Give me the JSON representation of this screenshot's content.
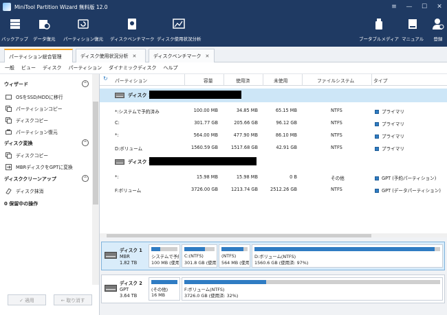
{
  "window": {
    "title": "MiniTool Partition Wizard 無料版 12.0"
  },
  "toolbar": {
    "items": [
      {
        "label": "バックアップ",
        "icon": "backup-icon"
      },
      {
        "label": "データ復元",
        "icon": "data-recovery-icon"
      },
      {
        "label": "パーティション復元",
        "icon": "partition-recovery-icon"
      },
      {
        "label": "ディスクベンチマーク",
        "icon": "disk-benchmark-icon"
      },
      {
        "label": "ディスク使用状況分析",
        "icon": "space-analyzer-icon"
      },
      {
        "label": "ブータブルメディア",
        "icon": "bootable-media-icon"
      },
      {
        "label": "マニュアル",
        "icon": "manual-icon"
      },
      {
        "label": "登録",
        "icon": "register-icon"
      }
    ]
  },
  "tabs": [
    {
      "label": "パーティション総合管理"
    },
    {
      "label": "ディスク使用状況分析"
    },
    {
      "label": "ディスクベンチマーク"
    }
  ],
  "menu": [
    "一般",
    "ビュー",
    "ディスク",
    "パーティション",
    "ダイナミックディスク",
    "ヘルプ"
  ],
  "sidebar": {
    "wizard": {
      "title": "ウィザード",
      "items": [
        "OSをSSD/HDDに移行",
        "パーティションコピー",
        "ディスクコピー",
        "パーティション復元"
      ]
    },
    "convert": {
      "title": "ディスク変換",
      "items": [
        "ディスクコピー",
        "MBRディスクをGPTに変換"
      ]
    },
    "cleanup": {
      "title": "ディスククリーンアップ",
      "items": [
        "ディスク抹消"
      ]
    },
    "pending": "0 保留中の操作",
    "apply": "✓ 適用",
    "undo": "← 取り消す"
  },
  "table": {
    "headers": [
      "パーティション",
      "容量",
      "使用済",
      "未使用",
      "ファイルシステム",
      "タイプ"
    ],
    "disk1": {
      "name": "ディスク 1"
    },
    "disk1_rows": [
      [
        "*:システムで予約済み",
        "100.00 MB",
        "34.85 MB",
        "65.15 MB",
        "NTFS",
        "プライマリ"
      ],
      [
        "C:",
        "301.77 GB",
        "205.66 GB",
        "96.12 GB",
        "NTFS",
        "プライマリ"
      ],
      [
        "*:",
        "564.00 MB",
        "477.90 MB",
        "86.10 MB",
        "NTFS",
        "プライマリ"
      ],
      [
        "D:ボリューム",
        "1560.59 GB",
        "1517.68 GB",
        "42.91 GB",
        "NTFS",
        "プライマリ"
      ]
    ],
    "disk2": {
      "name": "ディスク 2"
    },
    "disk2_rows": [
      [
        "*:",
        "15.98 MB",
        "15.98 MB",
        "0 B",
        "その他",
        "GPT (予約パーティション)"
      ],
      [
        "F:ボリューム",
        "3726.00 GB",
        "1213.74 GB",
        "2512.26 GB",
        "NTFS",
        "GPT (データパーティション)"
      ]
    ]
  },
  "diskmap": {
    "disk1": {
      "name": "ディスク 1",
      "style": "MBR",
      "size": "1.82 TB",
      "blocks": [
        {
          "l1": "システムで予約",
          "l2": "100 MB (使用",
          "fill": 0.35
        },
        {
          "l1": "C:(NTFS)",
          "l2": "301.8 GB (使用",
          "fill": 0.68
        },
        {
          "l1": "(NTFS)",
          "l2": "564 MB (使用",
          "fill": 0.85
        },
        {
          "l1": "D:ボリューム(NTFS)",
          "l2": "1560.6 GB (使用済: 97%)",
          "fill": 0.97
        }
      ]
    },
    "disk2": {
      "name": "ディスク 2",
      "style": "GPT",
      "size": "3.64 TB",
      "blocks": [
        {
          "l1": "(その他)",
          "l2": "16 MB",
          "fill": 1.0
        },
        {
          "l1": "F:ボリューム(NTFS)",
          "l2": "3726.0 GB (使用済: 32%)",
          "fill": 0.32
        }
      ]
    }
  },
  "colors": {
    "titlebar": "#1f3a63",
    "accent": "#2f7cc3",
    "tab_active": "#f6a623",
    "selected_row": "#cde6f7"
  }
}
